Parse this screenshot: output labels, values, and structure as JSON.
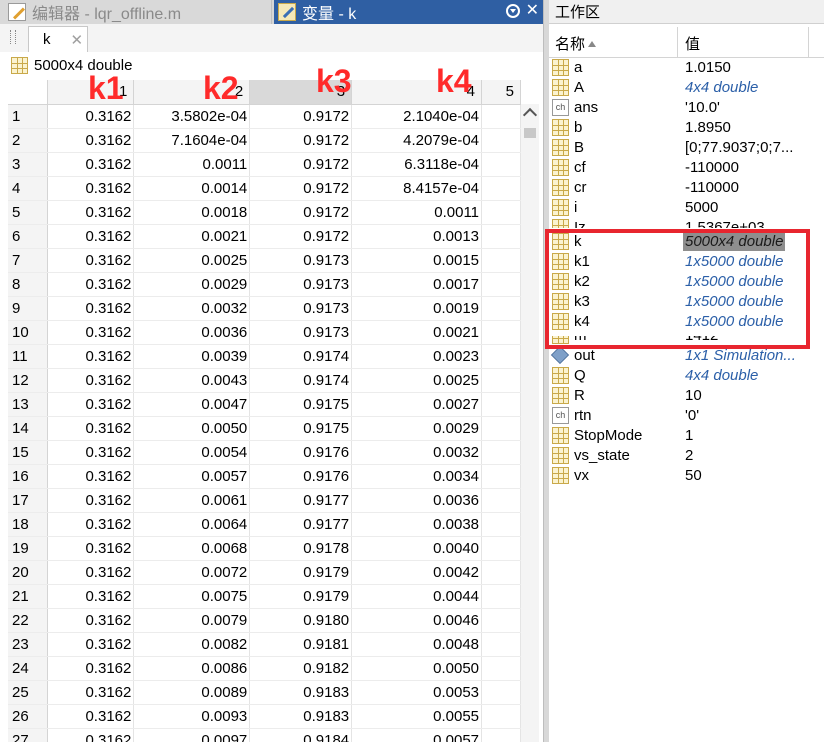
{
  "doc_tabs": {
    "editor_label": "编辑器 - lqr_offline.m",
    "variable_label": "变量 - k",
    "menu_icon": "circle-chevron-down-icon",
    "close_icon": "close-icon"
  },
  "var_tabs": [
    {
      "label": "k",
      "close": "✕"
    }
  ],
  "var_info": "5000x4 double",
  "table": {
    "column_headers": [
      "1",
      "2",
      "3",
      "4",
      "5"
    ],
    "rows": [
      {
        "n": "1",
        "c": [
          "0.3162",
          "3.5802e-04",
          "0.9172",
          "2.1040e-04"
        ]
      },
      {
        "n": "2",
        "c": [
          "0.3162",
          "7.1604e-04",
          "0.9172",
          "4.2079e-04"
        ]
      },
      {
        "n": "3",
        "c": [
          "0.3162",
          "0.0011",
          "0.9172",
          "6.3118e-04"
        ]
      },
      {
        "n": "4",
        "c": [
          "0.3162",
          "0.0014",
          "0.9172",
          "8.4157e-04"
        ]
      },
      {
        "n": "5",
        "c": [
          "0.3162",
          "0.0018",
          "0.9172",
          "0.0011"
        ]
      },
      {
        "n": "6",
        "c": [
          "0.3162",
          "0.0021",
          "0.9172",
          "0.0013"
        ]
      },
      {
        "n": "7",
        "c": [
          "0.3162",
          "0.0025",
          "0.9173",
          "0.0015"
        ]
      },
      {
        "n": "8",
        "c": [
          "0.3162",
          "0.0029",
          "0.9173",
          "0.0017"
        ]
      },
      {
        "n": "9",
        "c": [
          "0.3162",
          "0.0032",
          "0.9173",
          "0.0019"
        ]
      },
      {
        "n": "10",
        "c": [
          "0.3162",
          "0.0036",
          "0.9173",
          "0.0021"
        ]
      },
      {
        "n": "11",
        "c": [
          "0.3162",
          "0.0039",
          "0.9174",
          "0.0023"
        ]
      },
      {
        "n": "12",
        "c": [
          "0.3162",
          "0.0043",
          "0.9174",
          "0.0025"
        ]
      },
      {
        "n": "13",
        "c": [
          "0.3162",
          "0.0047",
          "0.9175",
          "0.0027"
        ]
      },
      {
        "n": "14",
        "c": [
          "0.3162",
          "0.0050",
          "0.9175",
          "0.0029"
        ]
      },
      {
        "n": "15",
        "c": [
          "0.3162",
          "0.0054",
          "0.9176",
          "0.0032"
        ]
      },
      {
        "n": "16",
        "c": [
          "0.3162",
          "0.0057",
          "0.9176",
          "0.0034"
        ]
      },
      {
        "n": "17",
        "c": [
          "0.3162",
          "0.0061",
          "0.9177",
          "0.0036"
        ]
      },
      {
        "n": "18",
        "c": [
          "0.3162",
          "0.0064",
          "0.9177",
          "0.0038"
        ]
      },
      {
        "n": "19",
        "c": [
          "0.3162",
          "0.0068",
          "0.9178",
          "0.0040"
        ]
      },
      {
        "n": "20",
        "c": [
          "0.3162",
          "0.0072",
          "0.9179",
          "0.0042"
        ]
      },
      {
        "n": "21",
        "c": [
          "0.3162",
          "0.0075",
          "0.9179",
          "0.0044"
        ]
      },
      {
        "n": "22",
        "c": [
          "0.3162",
          "0.0079",
          "0.9180",
          "0.0046"
        ]
      },
      {
        "n": "23",
        "c": [
          "0.3162",
          "0.0082",
          "0.9181",
          "0.0048"
        ]
      },
      {
        "n": "24",
        "c": [
          "0.3162",
          "0.0086",
          "0.9182",
          "0.0050"
        ]
      },
      {
        "n": "25",
        "c": [
          "0.3162",
          "0.0089",
          "0.9183",
          "0.0053"
        ]
      },
      {
        "n": "26",
        "c": [
          "0.3162",
          "0.0093",
          "0.9183",
          "0.0055"
        ]
      },
      {
        "n": "27",
        "c": [
          "0.3162",
          "0.0097",
          "0.9184",
          "0.0057"
        ]
      }
    ]
  },
  "annotations": [
    "k1",
    "k2",
    "k3",
    "k4"
  ],
  "annotation_color": "#ff2a2a",
  "workspace": {
    "title": "工作区",
    "col_name": "名称",
    "col_value": "值",
    "vars": [
      {
        "name": "a",
        "value": "1.0150",
        "icon": "grid-icon"
      },
      {
        "name": "A",
        "value": "4x4 double",
        "icon": "grid-icon",
        "italic": true
      },
      {
        "name": "ans",
        "value": "'10.0'",
        "icon": "char-icon"
      },
      {
        "name": "b",
        "value": "1.8950",
        "icon": "grid-icon"
      },
      {
        "name": "B",
        "value": "[0;77.9037;0;7...",
        "icon": "grid-icon"
      },
      {
        "name": "cf",
        "value": "-110000",
        "icon": "grid-icon"
      },
      {
        "name": "cr",
        "value": "-110000",
        "icon": "grid-icon"
      },
      {
        "name": "i",
        "value": "5000",
        "icon": "grid-icon"
      },
      {
        "name": "Iz",
        "value": "1.5367e+03",
        "icon": "grid-icon",
        "clipped": true
      },
      {
        "name": "k",
        "value": "5000x4 double",
        "icon": "grid-icon",
        "selected": true
      },
      {
        "name": "k1",
        "value": "1x5000 double",
        "icon": "grid-icon",
        "italic": true
      },
      {
        "name": "k2",
        "value": "1x5000 double",
        "icon": "grid-icon",
        "italic": true
      },
      {
        "name": "k3",
        "value": "1x5000 double",
        "icon": "grid-icon",
        "italic": true
      },
      {
        "name": "k4",
        "value": "1x5000 double",
        "icon": "grid-icon",
        "italic": true
      },
      {
        "name": "m",
        "value": "1412",
        "icon": "grid-icon",
        "clipped_bottom": true
      },
      {
        "name": "out",
        "value": "1x1 Simulation...",
        "icon": "cube-icon",
        "italic": true
      },
      {
        "name": "Q",
        "value": "4x4 double",
        "icon": "grid-icon",
        "italic": true
      },
      {
        "name": "R",
        "value": "10",
        "icon": "grid-icon"
      },
      {
        "name": "rtn",
        "value": "'0'",
        "icon": "char-icon"
      },
      {
        "name": "StopMode",
        "value": "1",
        "icon": "grid-icon"
      },
      {
        "name": "vs_state",
        "value": "2",
        "icon": "grid-icon"
      },
      {
        "name": "vx",
        "value": "50",
        "icon": "grid-icon"
      }
    ],
    "highlight_color": "#e8262f"
  }
}
